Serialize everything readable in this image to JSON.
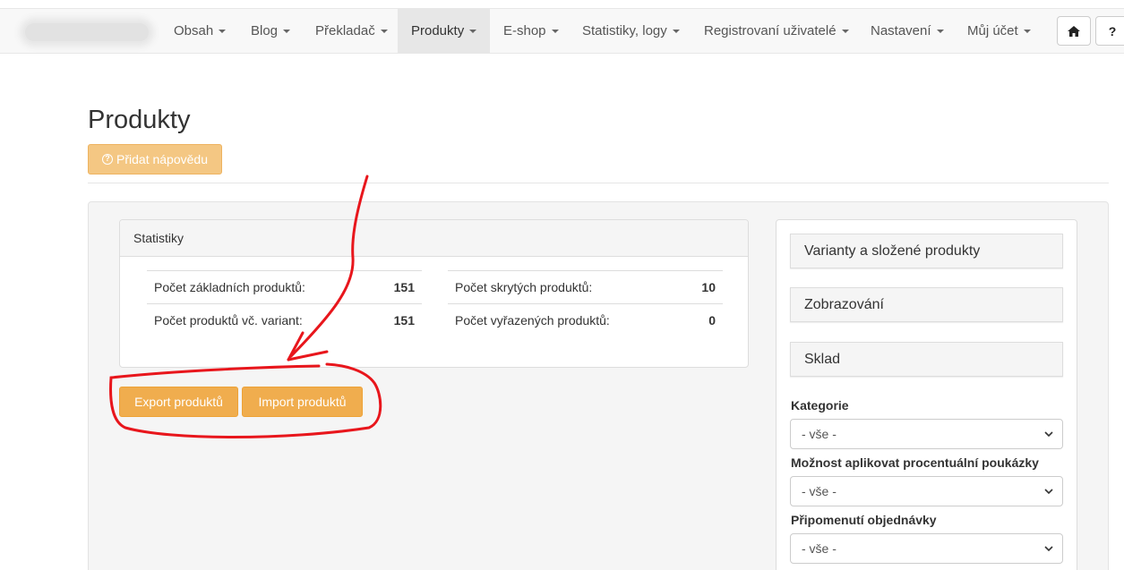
{
  "navbar": {
    "items": [
      {
        "label": "Obsah",
        "active": false
      },
      {
        "label": "Blog",
        "active": false
      },
      {
        "label": "Překladač",
        "active": false
      },
      {
        "label": "Produkty",
        "active": true
      },
      {
        "label": "E-shop",
        "active": false
      },
      {
        "label": "Statistiky, logy",
        "active": false
      },
      {
        "label": "Registrovaní uživatelé",
        "active": false
      },
      {
        "label": "Nastavení",
        "active": false
      },
      {
        "label": "Můj účet",
        "active": false
      }
    ],
    "home_icon": "home-icon",
    "help_label": "?"
  },
  "page": {
    "title": "Produkty",
    "help_button_label": "Přidat nápovědu",
    "help_icon": "question-circle-icon"
  },
  "stats": {
    "heading": "Statistiky",
    "left": [
      {
        "label": "Počet základních produktů:",
        "value": "151"
      },
      {
        "label": "Počet produktů vč. variant:",
        "value": "151"
      }
    ],
    "right": [
      {
        "label": "Počet skrytých produktů:",
        "value": "10"
      },
      {
        "label": "Počet vyřazených produktů:",
        "value": "0"
      }
    ]
  },
  "actions": {
    "export_label": "Export produktů",
    "import_label": "Import produktů"
  },
  "filters": {
    "sections": [
      "Varianty a složené produkty",
      "Zobrazování",
      "Sklad"
    ],
    "fields": [
      {
        "label": "Kategorie",
        "value": "- vše -"
      },
      {
        "label": "Možnost aplikovat procentuální poukázky",
        "value": "- vše -"
      },
      {
        "label": "Připomenutí objednávky",
        "value": "- vše -"
      }
    ]
  },
  "colors": {
    "warning": "#f0ad4e",
    "annotation": "#e8161c"
  }
}
